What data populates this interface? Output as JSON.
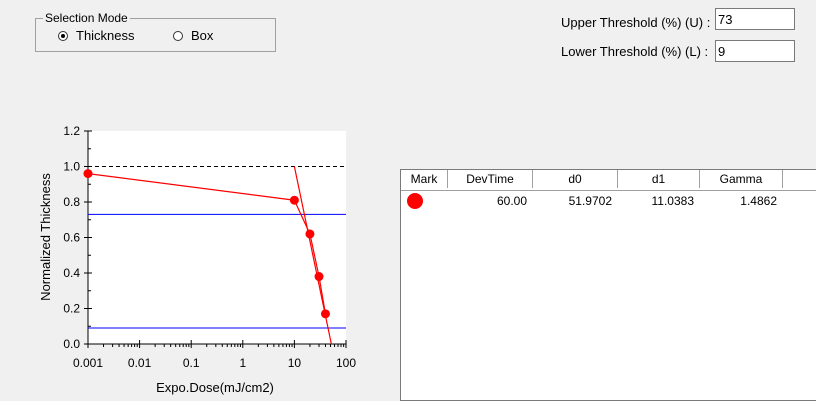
{
  "selection_mode": {
    "title": "Selection Mode",
    "options": [
      {
        "label": "Thickness",
        "checked": true
      },
      {
        "label": "Box",
        "checked": false
      }
    ]
  },
  "thresholds": {
    "upper_label": "Upper Threshold (%) (U) :",
    "upper_value": "73",
    "lower_label": "Lower Threshold (%) (L) :",
    "lower_value": "9"
  },
  "chart_data": {
    "type": "scatter",
    "xlabel": "Expo.Dose(mJ/cm2)",
    "ylabel": "Normalized Thickness",
    "x_scale": "log",
    "xlim": [
      0.001,
      100
    ],
    "ylim": [
      0.0,
      1.2
    ],
    "x_ticks": [
      "0.001",
      "0.01",
      "0.1",
      "1",
      "10",
      "100"
    ],
    "y_ticks": [
      "0.0",
      "0.2",
      "0.4",
      "0.6",
      "0.8",
      "1.0",
      "1.2"
    ],
    "reference_line": 1.0,
    "threshold_lines": [
      0.73,
      0.09
    ],
    "points": [
      {
        "x": 0.001,
        "y": 0.96
      },
      {
        "x": 10,
        "y": 0.81
      },
      {
        "x": 20,
        "y": 0.62
      },
      {
        "x": 30,
        "y": 0.38
      },
      {
        "x": 40,
        "y": 0.17
      }
    ],
    "fit_line": [
      {
        "x": 10,
        "y": 1.0
      },
      {
        "x": 52,
        "y": 0.0
      }
    ],
    "colors": {
      "data": "#ff0000",
      "threshold": "#0000ff",
      "reference": "#000000"
    }
  },
  "table": {
    "headers": [
      "Mark",
      "DevTime",
      "d0",
      "d1",
      "Gamma"
    ],
    "rows": [
      {
        "mark_color": "#ff0000",
        "devtime": "60.00",
        "d0": "51.9702",
        "d1": "11.0383",
        "gamma": "1.4862"
      }
    ]
  }
}
